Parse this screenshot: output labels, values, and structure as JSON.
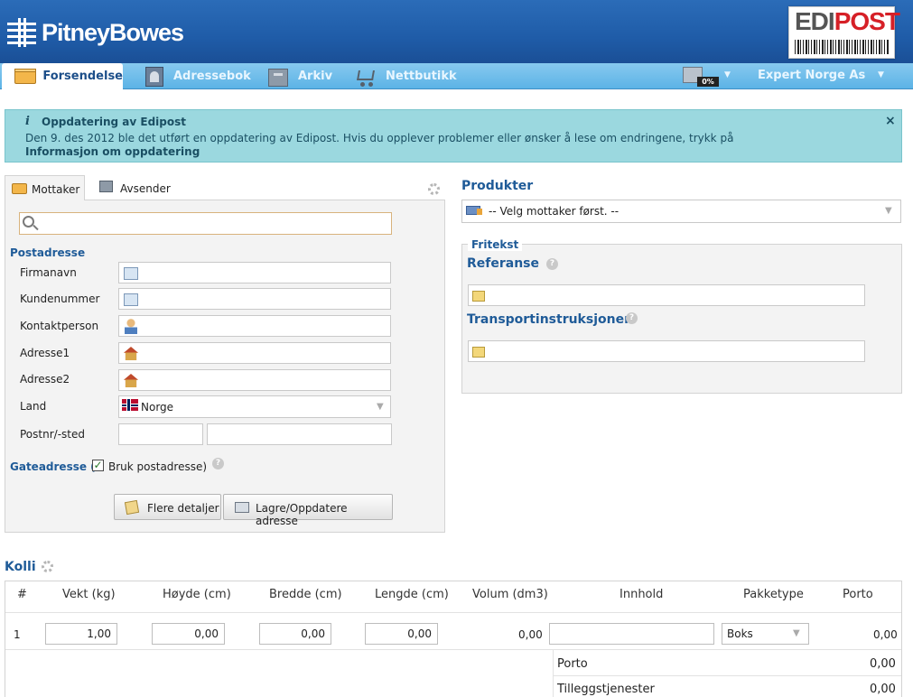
{
  "header": {
    "brand": "PitneyBowes",
    "product_logo_a": "EDI",
    "product_logo_b": "POST"
  },
  "nav": {
    "tabs": [
      {
        "label": "Forsendelse",
        "icon": "package-icon"
      },
      {
        "label": "Adressebok",
        "icon": "address-book-icon"
      },
      {
        "label": "Arkiv",
        "icon": "archive-icon"
      },
      {
        "label": "Nettbutikk",
        "icon": "shopping-cart-icon"
      }
    ],
    "printer_percent": "0%",
    "company": "Expert Norge As"
  },
  "notice": {
    "title": "Oppdatering av Edipost",
    "body": "Den 9. des 2012 ble det utført en oppdatering av Edipost. Hvis du opplever problemer eller ønsker å lese om endringene, trykk på",
    "link": "Informasjon om oppdatering",
    "close": "×"
  },
  "address": {
    "tabs": [
      "Mottaker",
      "Avsender"
    ],
    "section_post": "Postadresse",
    "fields": [
      "Firmanavn",
      "Kundenummer",
      "Kontaktperson",
      "Adresse1",
      "Adresse2",
      "Land",
      "Postnr/-sted"
    ],
    "country": "Norge",
    "section_gate": "Gateadresse (",
    "use_post": "Bruk postadresse)",
    "btn_details": "Flere detaljer",
    "btn_save": "Lagre/Oppdatere adresse"
  },
  "products": {
    "title": "Produkter",
    "placeholder": "-- Velg mottaker først. --",
    "fritekst": "Fritekst",
    "referanse": "Referanse",
    "transport": "Transportinstruksjoner"
  },
  "kolli": {
    "title": "Kolli",
    "columns": [
      "#",
      "Vekt (kg)",
      "Høyde (cm)",
      "Bredde (cm)",
      "Lengde (cm)",
      "Volum (dm3)",
      "Innhold",
      "Pakketype",
      "Porto"
    ],
    "row": {
      "num": "1",
      "vekt": "1,00",
      "hoyde": "0,00",
      "bredde": "0,00",
      "lengde": "0,00",
      "volum": "0,00",
      "innhold": "",
      "pakketype": "Boks",
      "porto": "0,00"
    },
    "totals": [
      {
        "label": "Porto",
        "value": "0,00"
      },
      {
        "label": "Tilleggstjenester",
        "value": "0,00"
      }
    ]
  },
  "colors": {
    "header": "#1f5ca8",
    "nav": "#5cb3e6",
    "notice": "#9bd8df",
    "section": "#1f5b98"
  }
}
